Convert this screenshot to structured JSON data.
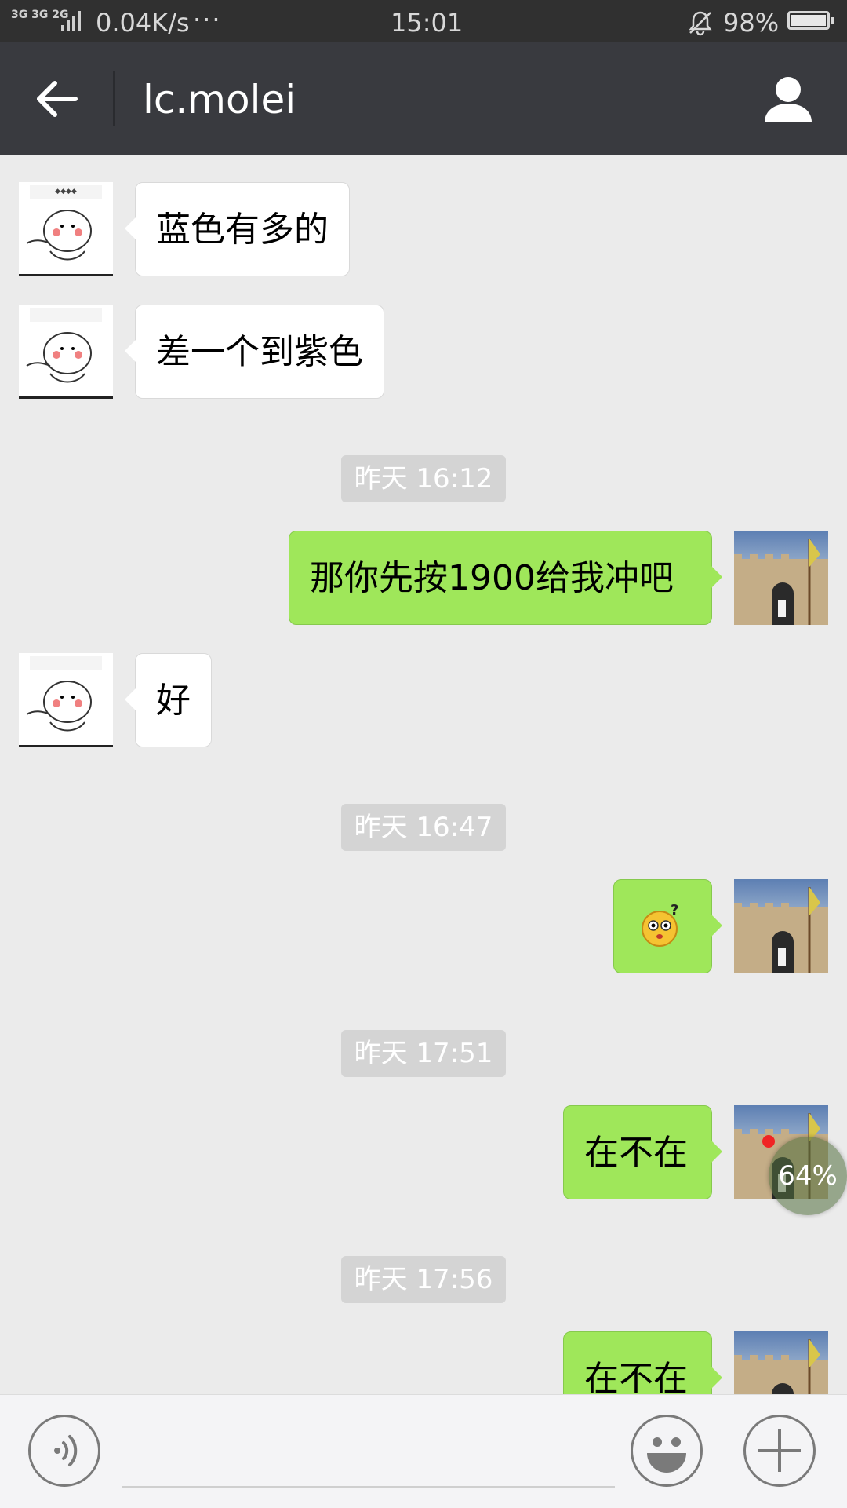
{
  "status_bar": {
    "network": "3G 3G 2G",
    "speed": "0.04K/s",
    "more": "···",
    "time": "15:01",
    "battery": "98%",
    "battery_level": 0.98
  },
  "header": {
    "back_icon": "arrow-left-icon",
    "title": "lc.molei",
    "profile_icon": "person-icon"
  },
  "messages": [
    {
      "side": "left",
      "text": "蓝色有多的"
    },
    {
      "side": "left",
      "text": "差一个到紫色"
    },
    {
      "type": "timestamp",
      "text": "昨天 16:12"
    },
    {
      "side": "right",
      "text": "那你先按1900给我冲吧"
    },
    {
      "side": "left",
      "text": "好"
    },
    {
      "type": "timestamp",
      "text": "昨天 16:47"
    },
    {
      "side": "right",
      "emoji": "confused-face-emoji"
    },
    {
      "type": "timestamp",
      "text": "昨天 17:51"
    },
    {
      "side": "right",
      "text": "在不在"
    },
    {
      "type": "timestamp",
      "text": "昨天 17:56"
    },
    {
      "side": "right",
      "text": "在不在"
    }
  ],
  "floating_widget": {
    "label": "64%"
  },
  "input_bar": {
    "voice_icon": "voice-icon",
    "emoji_icon": "smiley-icon",
    "plus_icon": "plus-icon",
    "input_value": ""
  },
  "colors": {
    "header_bg": "#393a3f",
    "chat_bg": "#ebebeb",
    "sent_bubble": "#9fe75a",
    "received_bubble": "#ffffff"
  }
}
